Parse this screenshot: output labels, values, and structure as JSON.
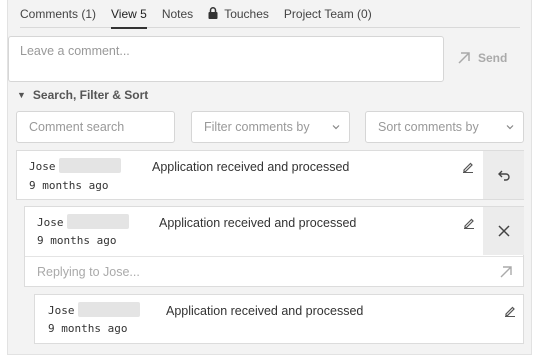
{
  "tabs": [
    {
      "label": "Comments (1)"
    },
    {
      "label": "View 5"
    },
    {
      "label": "Notes"
    },
    {
      "label": "Touches"
    },
    {
      "label": "Project Team (0)"
    }
  ],
  "comment_input": {
    "placeholder": "Leave a comment..."
  },
  "send_label": "Send",
  "search_section": {
    "title": "Search, Filter & Sort"
  },
  "filters": {
    "search_placeholder": "Comment search",
    "filter_placeholder": "Filter comments by",
    "sort_placeholder": "Sort comments by"
  },
  "comments": [
    {
      "author": "Jose",
      "time": "9 months ago",
      "text": "Application received and processed"
    },
    {
      "author": "Jose",
      "time": "9 months ago",
      "text": "Application received and processed"
    },
    {
      "author": "Jose",
      "time": "9 months ago",
      "text": "Application received and processed"
    }
  ],
  "reply": {
    "placeholder": "Replying to Jose..."
  },
  "icons": {
    "tab_touches": "lock-icon",
    "send": "arrow-up-right-icon",
    "reply": "reply-icon",
    "close": "close-icon",
    "edit": "pencil-icon"
  }
}
